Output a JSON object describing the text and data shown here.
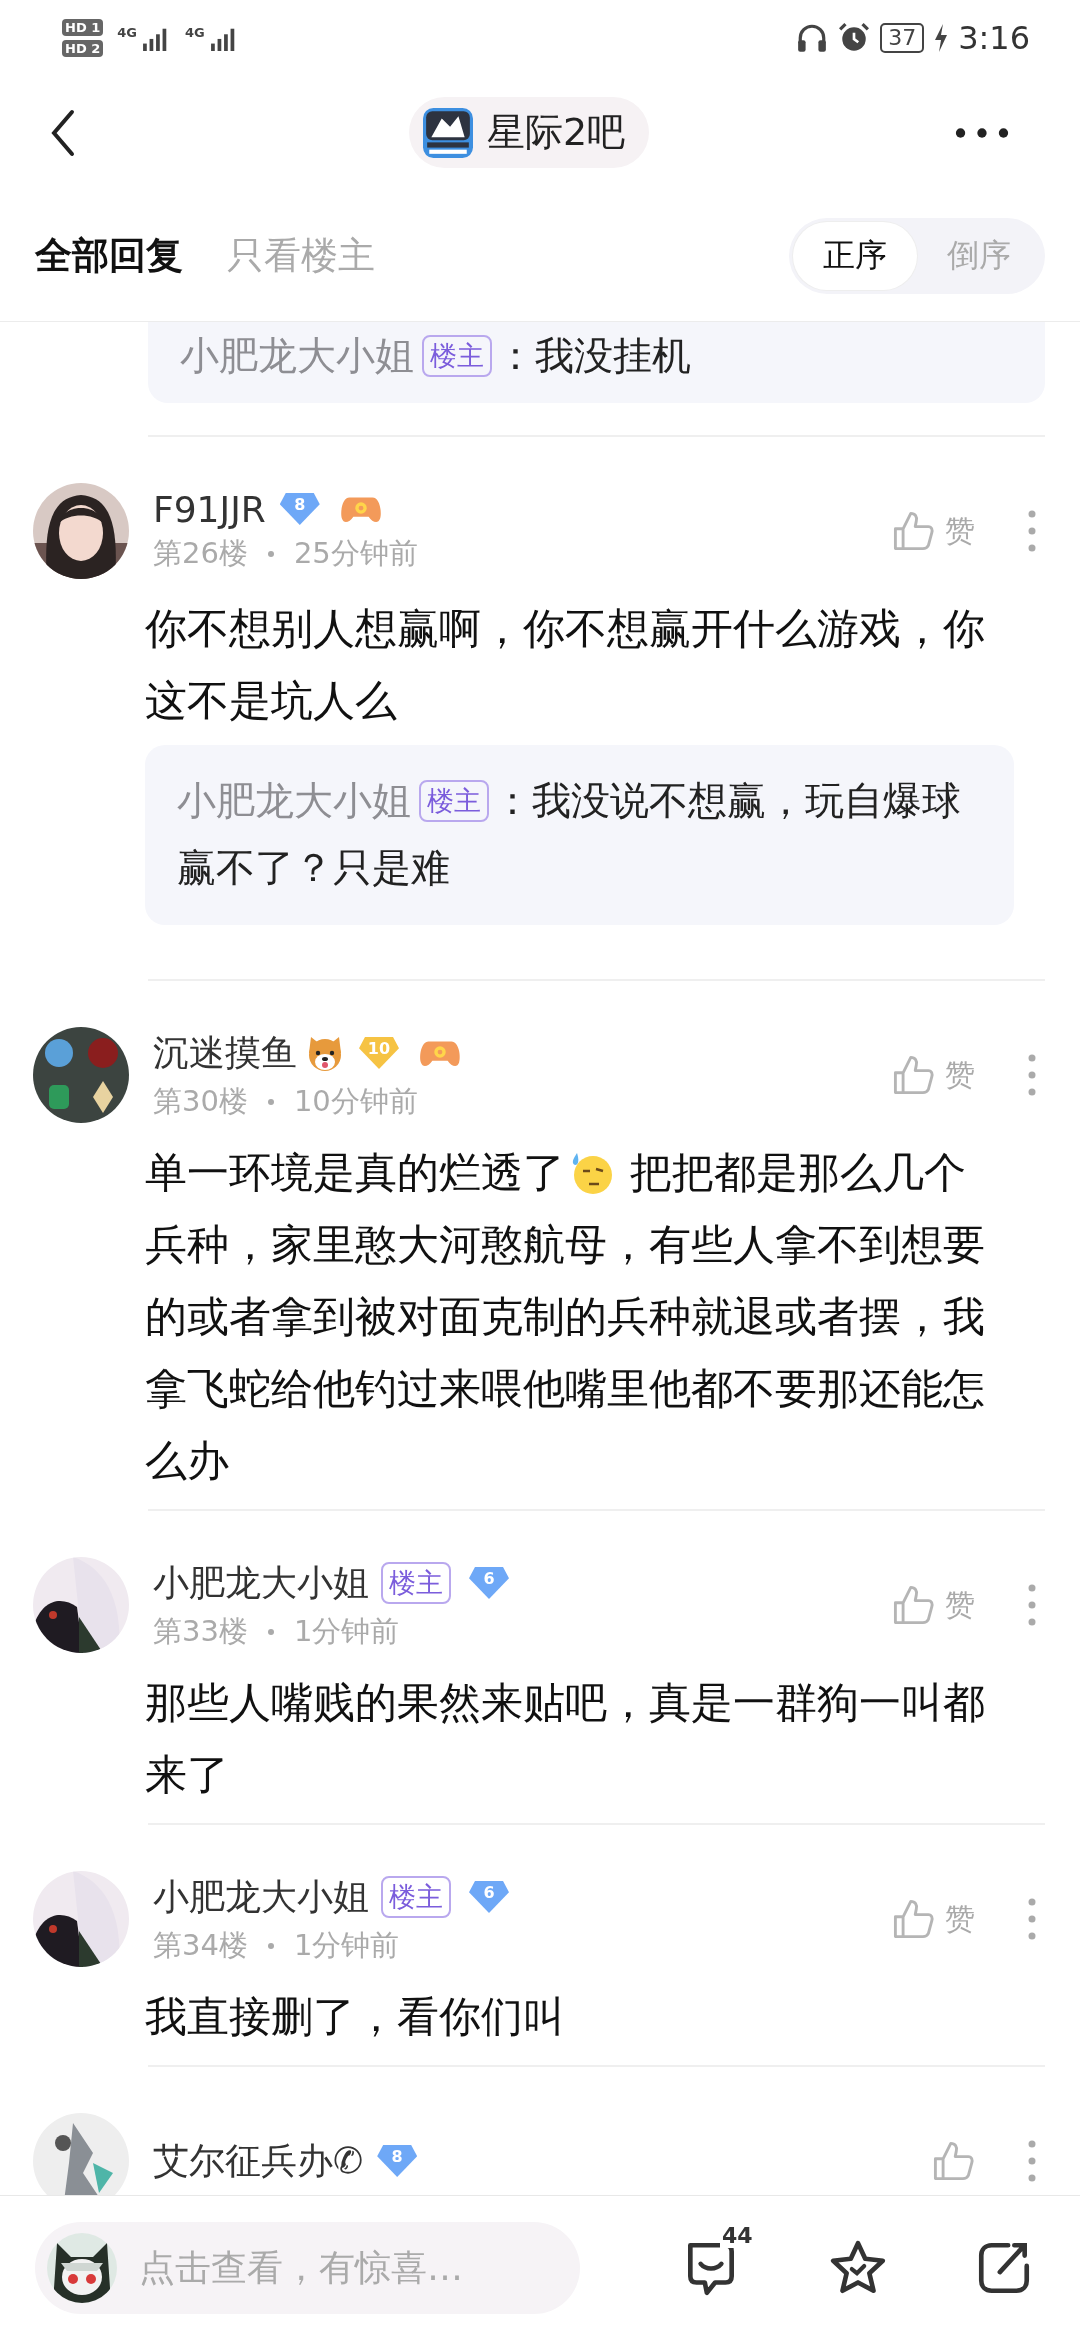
{
  "status_bar": {
    "sims": [
      "HD 1",
      "HD 2"
    ],
    "networks": [
      "4G",
      "4G"
    ],
    "battery": "37",
    "time": "3:16"
  },
  "header": {
    "forum_name": "星际2吧"
  },
  "filter_tabs": [
    {
      "label": "全部回复",
      "selected": true
    },
    {
      "label": "只看楼主",
      "selected": false
    }
  ],
  "sort_options": [
    {
      "label": "正序",
      "selected": true
    },
    {
      "label": "倒序",
      "selected": false
    }
  ],
  "cut_quote": {
    "author": "小肥龙大小姐",
    "op_badge": "楼主",
    "text": "：我没挂机"
  },
  "posts": [
    {
      "author": "F91JJR",
      "emblems": [
        {
          "kind": "grade",
          "text": "8",
          "color": "#6ea8f7"
        },
        {
          "kind": "controller"
        }
      ],
      "floor": "第26楼",
      "time": "25分钟前",
      "like_label": "赞",
      "body": [
        {
          "kind": "block",
          "text": "你不想别人想赢啊，你不想赢开什么游戏，你这不是坑人么"
        }
      ],
      "quote": {
        "author": "小肥龙大小姐",
        "op_badge": "楼主",
        "text": "：我没说不想赢，玩自爆球赢不了？只是难"
      }
    },
    {
      "author": "沉迷摸鱼",
      "emblems": [
        {
          "kind": "shiba"
        },
        {
          "kind": "grade",
          "text": "10",
          "color": "#f6c343"
        },
        {
          "kind": "controller"
        }
      ],
      "floor": "第30楼",
      "time": "10分钟前",
      "like_label": "赞",
      "body": [
        {
          "kind": "text",
          "text": "单一环境是真的烂透了"
        },
        {
          "kind": "emoji"
        },
        {
          "kind": "text",
          "text": " 把把都是那么几个"
        },
        {
          "kind": "block",
          "text": "兵种，家里憨大河憨航母，有些人拿不到想要的或者拿到被对面克制的兵种就退或者摆，我拿飞蛇给他钓过来喂他嘴里他都不要那还能怎么办"
        }
      ]
    },
    {
      "author": "小肥龙大小姐",
      "emblems": [
        {
          "kind": "op",
          "text": "楼主"
        },
        {
          "kind": "grade",
          "text": "6",
          "color": "#6ea8f7"
        }
      ],
      "floor": "第33楼",
      "time": "1分钟前",
      "like_label": "赞",
      "body": [
        {
          "kind": "block",
          "text": "那些人嘴贱的果然来贴吧，真是一群狗一叫都来了"
        }
      ]
    },
    {
      "author": "小肥龙大小姐",
      "emblems": [
        {
          "kind": "op",
          "text": "楼主"
        },
        {
          "kind": "grade",
          "text": "6",
          "color": "#6ea8f7"
        }
      ],
      "floor": "第34楼",
      "time": "1分钟前",
      "like_label": "赞",
      "body": [
        {
          "kind": "block",
          "text": "我直接删了，看你们叫"
        }
      ]
    },
    {
      "author": "艾尔征兵办✆",
      "emblems": [
        {
          "kind": "grade",
          "text": "8",
          "color": "#6ea8f7"
        }
      ]
    }
  ],
  "composer": {
    "placeholder": "点击查看，有惊喜…"
  },
  "comment_count": "44"
}
